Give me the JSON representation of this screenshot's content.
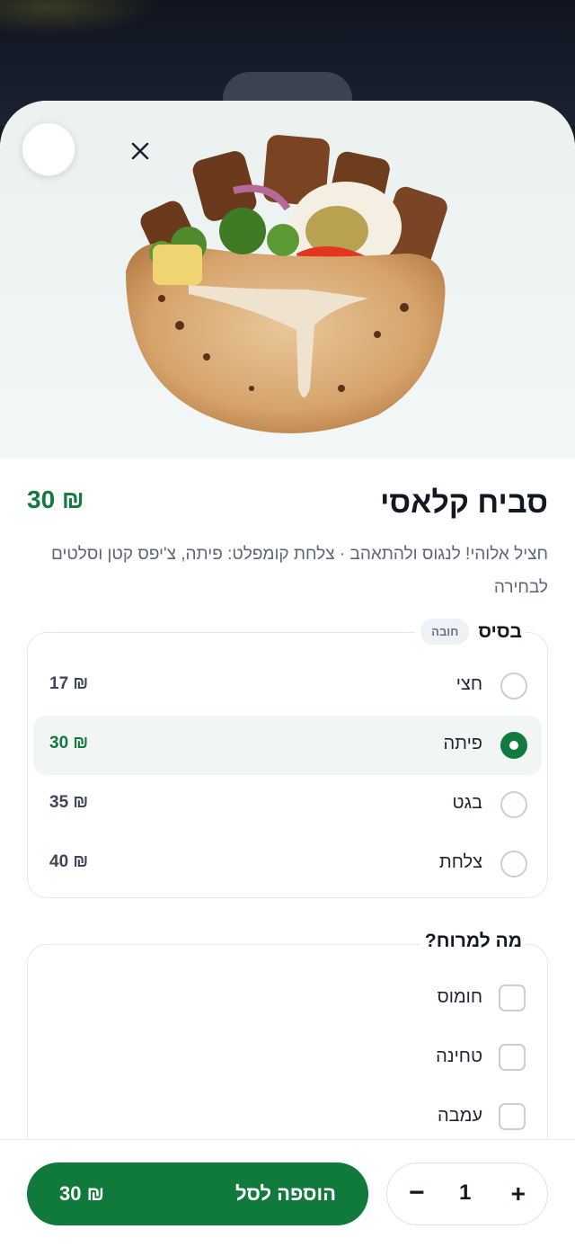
{
  "item": {
    "title": "סביח קלאסי",
    "price": "30 ₪",
    "description": "חציל אלוהי! לנגוס ולהתאהב · צלחת קומפלט: פיתה, צ'יפס קטן וסלטים לבחירה"
  },
  "base_group": {
    "title": "בסיס",
    "badge": "חובה",
    "options": [
      {
        "label": "חצי",
        "price": "17 ₪",
        "selected": false
      },
      {
        "label": "פיתה",
        "price": "30 ₪",
        "selected": true
      },
      {
        "label": "בגט",
        "price": "35 ₪",
        "selected": false
      },
      {
        "label": "צלחת",
        "price": "40 ₪",
        "selected": false
      }
    ]
  },
  "spread_group": {
    "title": "מה למרוח?",
    "options": [
      {
        "label": "חומוס",
        "checked": false
      },
      {
        "label": "טחינה",
        "checked": false
      },
      {
        "label": "עמבה",
        "checked": false
      }
    ]
  },
  "footer": {
    "add_label": "הוספה לסל",
    "add_price": "30 ₪",
    "quantity": "1",
    "plus": "+",
    "minus": "−"
  },
  "colors": {
    "accent": "#117a3f",
    "text": "#131722",
    "muted": "#5f6677"
  },
  "icons": {
    "close": "close-icon"
  }
}
